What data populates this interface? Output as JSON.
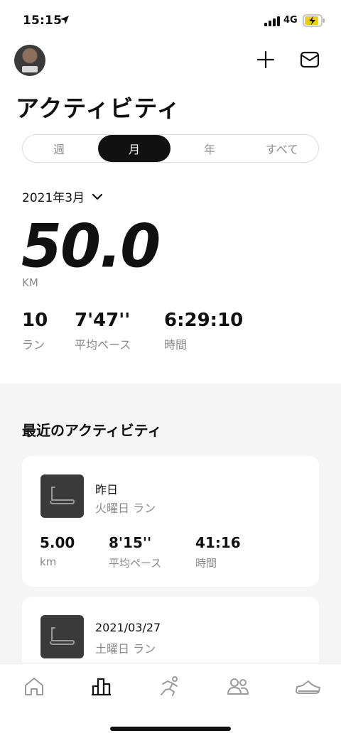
{
  "status": {
    "time": "15:15",
    "network": "4G"
  },
  "header": {
    "title": "アクティビティ"
  },
  "segments": [
    {
      "label": "週",
      "active": false
    },
    {
      "label": "月",
      "active": true
    },
    {
      "label": "年",
      "active": false
    },
    {
      "label": "すべて",
      "active": false
    }
  ],
  "period": {
    "label": "2021年3月"
  },
  "summary": {
    "distance": "50.0",
    "unit": "KM",
    "stats": [
      {
        "value": "10",
        "label": "ラン"
      },
      {
        "value": "7'47''",
        "label": "平均ペース"
      },
      {
        "value": "6:29:10",
        "label": "時間"
      }
    ]
  },
  "recent": {
    "title": "最近のアクティビティ",
    "items": [
      {
        "date": "昨日",
        "type": "火曜日 ラン",
        "stats": [
          {
            "value": "5.00",
            "label": "km"
          },
          {
            "value": "8'15''",
            "label": "平均ペース"
          },
          {
            "value": "41:16",
            "label": "時間"
          }
        ]
      },
      {
        "date": "2021/03/27",
        "type": "土曜日 ラン"
      }
    ]
  },
  "tabbar": {
    "icons": [
      "home-icon",
      "activity-chart-icon",
      "run-icon",
      "club-icon",
      "shoe-icon"
    ],
    "active": "activity-chart-icon"
  },
  "colors": {
    "active_tab": "#111111",
    "inactive_tab": "#9a9a9a",
    "background_section": "#f5f5f5"
  }
}
